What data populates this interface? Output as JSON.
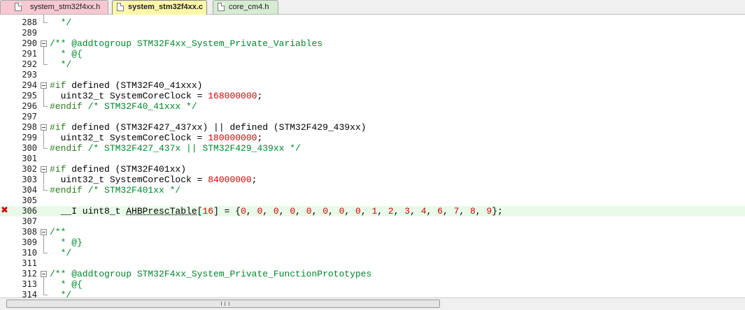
{
  "tabs": [
    {
      "label": "system_stm32f4xx.h",
      "icon": "file-icon"
    },
    {
      "label": "system_stm32f4xx.c",
      "icon": "file-icon",
      "active": true
    },
    {
      "label": "core_cm4.h",
      "icon": "file-icon"
    }
  ],
  "error_marker": "✖",
  "lines": [
    {
      "num": "288",
      "segs": [
        [
          "t-com",
          "  */"
        ]
      ]
    },
    {
      "num": "289",
      "segs": []
    },
    {
      "num": "290",
      "fold": true,
      "segs": [
        [
          "t-com",
          "/** @addtogroup STM32F4xx_System_Private_Variables"
        ]
      ]
    },
    {
      "num": "291",
      "segs": [
        [
          "t-com",
          "  * @{"
        ]
      ]
    },
    {
      "num": "292",
      "segs": [
        [
          "t-com",
          "  */"
        ]
      ]
    },
    {
      "num": "293",
      "segs": []
    },
    {
      "num": "294",
      "fold": true,
      "segs": [
        [
          "t-pre",
          "#if"
        ],
        [
          "t-def",
          " defined (STM32F40_41xxx)"
        ]
      ]
    },
    {
      "num": "295",
      "segs": [
        [
          "t-def",
          "  uint32_t SystemCoreClock = "
        ],
        [
          "t-num",
          "168000000"
        ],
        [
          "t-def",
          ";"
        ]
      ]
    },
    {
      "num": "296",
      "segs": [
        [
          "t-pre",
          "#endif"
        ],
        [
          "t-com",
          " /* STM32F40_41xxx */"
        ]
      ]
    },
    {
      "num": "297",
      "segs": []
    },
    {
      "num": "298",
      "fold": true,
      "segs": [
        [
          "t-pre",
          "#if"
        ],
        [
          "t-def",
          " defined (STM32F427_437xx) || defined (STM32F429_439xx)"
        ]
      ]
    },
    {
      "num": "299",
      "segs": [
        [
          "t-def",
          "  uint32_t SystemCoreClock = "
        ],
        [
          "t-num",
          "180000000"
        ],
        [
          "t-def",
          ";"
        ]
      ]
    },
    {
      "num": "300",
      "segs": [
        [
          "t-pre",
          "#endif"
        ],
        [
          "t-com",
          " /* STM32F427_437x || STM32F429_439xx */"
        ]
      ]
    },
    {
      "num": "301",
      "segs": []
    },
    {
      "num": "302",
      "fold": true,
      "segs": [
        [
          "t-pre",
          "#if"
        ],
        [
          "t-def",
          " defined (STM32F401xx)"
        ]
      ]
    },
    {
      "num": "303",
      "segs": [
        [
          "t-def",
          "  uint32_t SystemCoreClock = "
        ],
        [
          "t-num",
          "84000000"
        ],
        [
          "t-def",
          ";"
        ]
      ]
    },
    {
      "num": "304",
      "segs": [
        [
          "t-pre",
          "#endif"
        ],
        [
          "t-com",
          " /* STM32F401xx */"
        ]
      ]
    },
    {
      "num": "305",
      "segs": []
    },
    {
      "num": "306",
      "error": true,
      "highlight": true,
      "segs": [
        [
          "t-def",
          "  __I uint8_t "
        ],
        [
          "t-def t-ul",
          "AHBPrescTable"
        ],
        [
          "t-def",
          "["
        ],
        [
          "t-num",
          "16"
        ],
        [
          "t-def",
          "] = {"
        ],
        [
          "t-num",
          "0"
        ],
        [
          "t-def",
          ", "
        ],
        [
          "t-num",
          "0"
        ],
        [
          "t-def",
          ", "
        ],
        [
          "t-num",
          "0"
        ],
        [
          "t-def",
          ", "
        ],
        [
          "t-num",
          "0"
        ],
        [
          "t-def",
          ", "
        ],
        [
          "t-num",
          "0"
        ],
        [
          "t-def",
          ", "
        ],
        [
          "t-num",
          "0"
        ],
        [
          "t-def",
          ", "
        ],
        [
          "t-num",
          "0"
        ],
        [
          "t-def",
          ", "
        ],
        [
          "t-num",
          "0"
        ],
        [
          "t-def",
          ", "
        ],
        [
          "t-num",
          "1"
        ],
        [
          "t-def",
          ", "
        ],
        [
          "t-num",
          "2"
        ],
        [
          "t-def",
          ", "
        ],
        [
          "t-num",
          "3"
        ],
        [
          "t-def",
          ", "
        ],
        [
          "t-num",
          "4"
        ],
        [
          "t-def",
          ", "
        ],
        [
          "t-num",
          "6"
        ],
        [
          "t-def",
          ", "
        ],
        [
          "t-num",
          "7"
        ],
        [
          "t-def",
          ", "
        ],
        [
          "t-num",
          "8"
        ],
        [
          "t-def",
          ", "
        ],
        [
          "t-num",
          "9"
        ],
        [
          "t-def",
          "};"
        ]
      ]
    },
    {
      "num": "307",
      "segs": []
    },
    {
      "num": "308",
      "fold": true,
      "segs": [
        [
          "t-com",
          "/**"
        ]
      ]
    },
    {
      "num": "309",
      "segs": [
        [
          "t-com",
          "  * @}"
        ]
      ]
    },
    {
      "num": "310",
      "segs": [
        [
          "t-com",
          "  */"
        ]
      ]
    },
    {
      "num": "311",
      "segs": []
    },
    {
      "num": "312",
      "fold": true,
      "segs": [
        [
          "t-com",
          "/** @addtogroup STM32F4xx_System_Private_FunctionPrototypes"
        ]
      ]
    },
    {
      "num": "313",
      "segs": [
        [
          "t-com",
          "  * @{"
        ]
      ]
    },
    {
      "num": "314",
      "segs": [
        [
          "t-com",
          "  */"
        ]
      ]
    }
  ]
}
